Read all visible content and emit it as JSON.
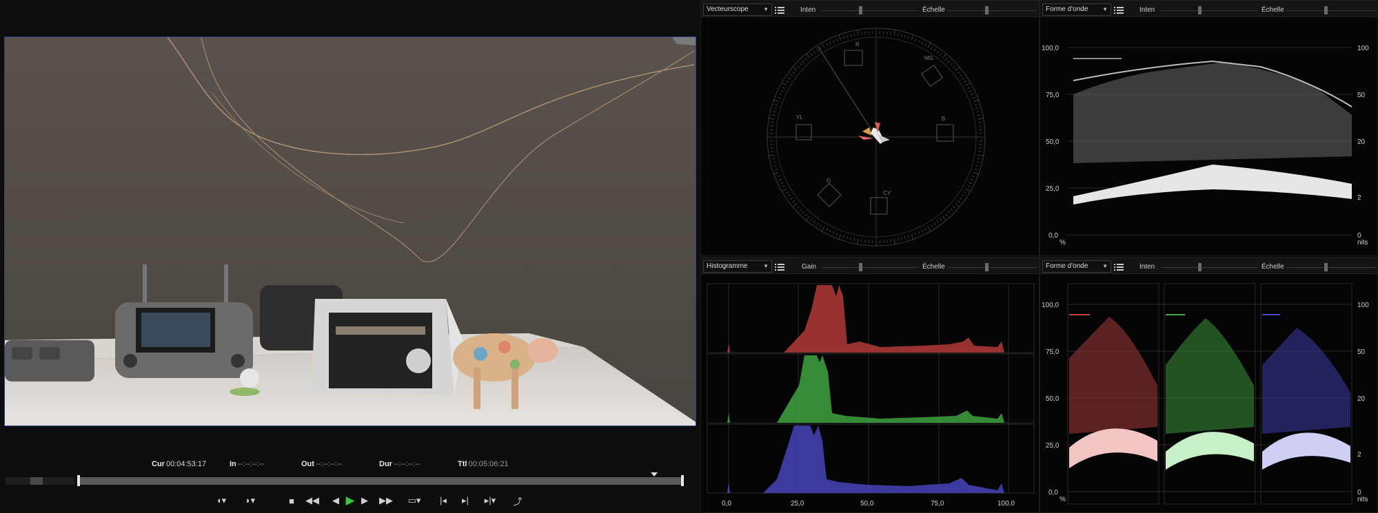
{
  "viewer": {
    "timecodes": [
      {
        "label": "Cur",
        "value": "00:04:53:17"
      },
      {
        "label": "In",
        "value": "--:--:--:--"
      },
      {
        "label": "Out",
        "value": "--:--:--:--"
      },
      {
        "label": "Dur",
        "value": "--:--:--:--"
      },
      {
        "label": "Ttl",
        "value": "00:05:06:21"
      }
    ]
  },
  "scopes": {
    "top_left": {
      "type": "Vecteurscope",
      "slider1": "Inten",
      "slider2": "Échelle",
      "targets": [
        "R",
        "MG",
        "B",
        "CY",
        "G",
        "YL"
      ]
    },
    "top_right": {
      "type": "Forme d'onde",
      "slider1": "Inten",
      "slider2": "Échelle",
      "left_axis": [
        "100,0",
        "75,0",
        "50,0",
        "25,0",
        "0,0"
      ],
      "left_unit": "%",
      "right_axis": [
        "100",
        "50",
        "20",
        "2",
        "0"
      ],
      "right_unit": "nits"
    },
    "bottom_left": {
      "type": "Histogramme",
      "slider1": "Gain",
      "slider2": "Échelle",
      "x_axis": [
        "0,0",
        "25,0",
        "50,0",
        "75,0",
        "100,0"
      ]
    },
    "bottom_right": {
      "type": "Forme d'onde",
      "slider1": "Inten",
      "slider2": "Échelle",
      "left_axis": [
        "100,0",
        "75,0",
        "50,0",
        "25,0",
        "0,0"
      ],
      "left_unit": "%",
      "right_axis": [
        "100",
        "50",
        "20",
        "2",
        "0"
      ],
      "right_unit": "nits"
    }
  },
  "colors": {
    "red": "#c8403e",
    "green": "#3fae3f",
    "blue": "#4b49c8",
    "accent_play": "#3cc43c"
  }
}
